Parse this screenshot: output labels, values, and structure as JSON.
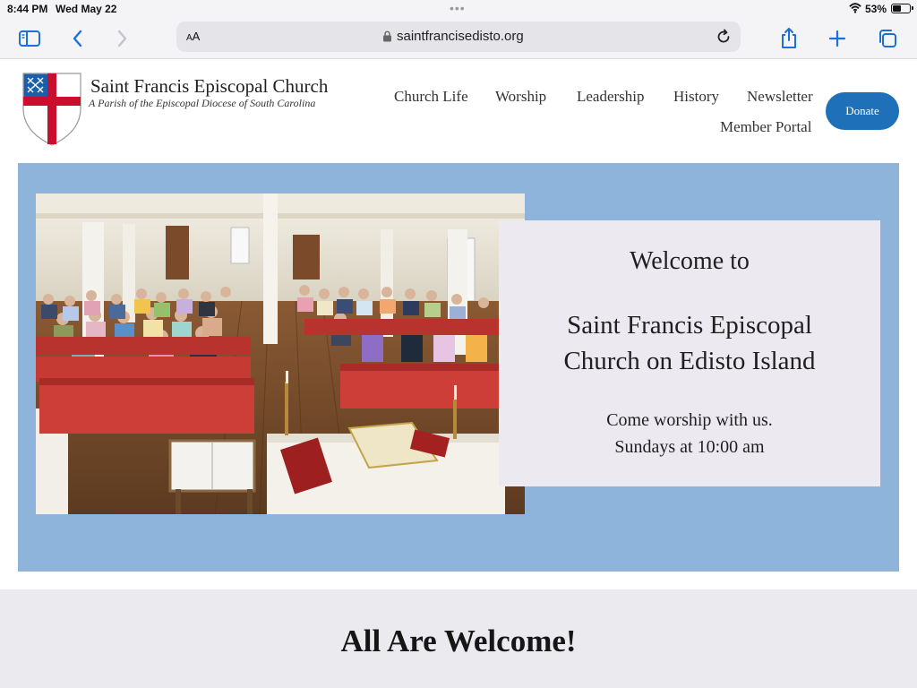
{
  "status_bar": {
    "time": "8:44 PM",
    "date": "Wed May 22",
    "battery_percent": "53%",
    "battery_level": 0.53,
    "wifi_icon": "wifi-icon"
  },
  "browser": {
    "reader_label_small": "A",
    "reader_label_large": "A",
    "url": "saintfrancisedisto.org",
    "icons": [
      "sidebar-icon",
      "back-icon",
      "forward-icon",
      "lock-icon",
      "reload-icon",
      "share-icon",
      "new-tab-icon",
      "tabs-icon"
    ]
  },
  "site": {
    "title": "Saint Francis Episcopal Church",
    "subtitle": "A Parish of the Episcopal Diocese of South Carolina",
    "nav": [
      {
        "label": "Church Life"
      },
      {
        "label": "Worship"
      },
      {
        "label": "Leadership"
      },
      {
        "label": "History"
      },
      {
        "label": "Newsletter"
      },
      {
        "label": "Member Portal"
      }
    ],
    "donate_label": "Donate",
    "colors": {
      "accent": "#1e70b8",
      "hero_bg": "#8fb4dc",
      "shield_red": "#c8102e",
      "shield_blue": "#1b5fa8"
    }
  },
  "hero": {
    "welcome_line1": "Welcome to",
    "welcome_line2": "Saint Francis Episcopal",
    "welcome_line3": "Church on Edisto Island",
    "worship_line1": "Come worship with us.",
    "worship_line2": "Sundays at 10:00 am"
  },
  "section": {
    "heading": "All Are Welcome!"
  }
}
